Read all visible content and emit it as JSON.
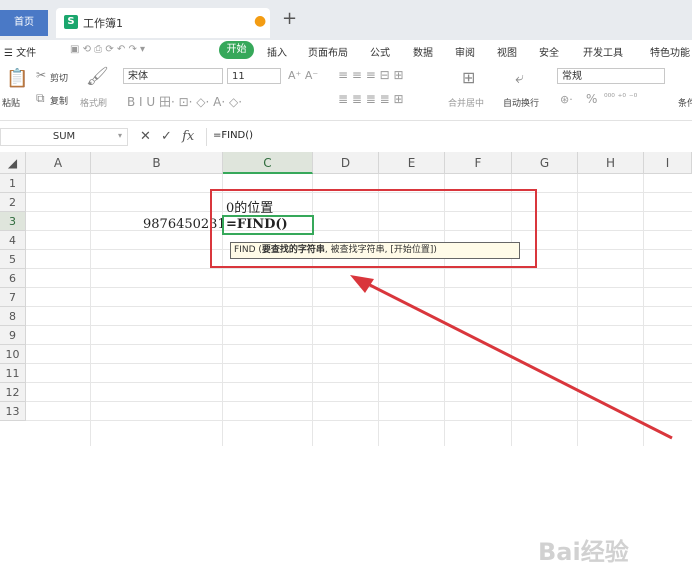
{
  "titlebar": {
    "home_label": "首页",
    "workbook_icon": "S",
    "workbook_name": "工作簿1",
    "new_tab": "+"
  },
  "menu": {
    "file": "☰ 文件",
    "start": "开始",
    "items": [
      "插入",
      "页面布局",
      "公式",
      "数据",
      "审阅",
      "视图",
      "安全",
      "开发工具",
      "特色功能"
    ]
  },
  "ribbon": {
    "cut": "剪切",
    "paste": "粘贴",
    "copy": "复制",
    "format_painter": "格式刷",
    "font_name": "宋体",
    "font_size": "11",
    "merge_center": "合并居中",
    "wrap_text": "自动换行",
    "number_format": "常规",
    "percent": "%",
    "conditional": "条件"
  },
  "formula_bar": {
    "name_box": "SUM",
    "cancel_icon": "✕",
    "confirm_icon": "✓",
    "fx": "fx",
    "formula": "=FIND()"
  },
  "columns": [
    "A",
    "B",
    "C",
    "D",
    "E",
    "F",
    "G",
    "H",
    "I"
  ],
  "rows": [
    "1",
    "2",
    "3",
    "4",
    "5",
    "6",
    "7",
    "8",
    "9",
    "10",
    "11",
    "12",
    "13"
  ],
  "cells": {
    "C2": "0的位置",
    "B3": "9876450231",
    "C3_edit": "=FIND()"
  },
  "tooltip": {
    "func": "FIND",
    "arg_current": "要查找的字符串",
    "rest": "被查找字符串, [开始位置])"
  },
  "watermark": "Bai经验",
  "colors": {
    "accent": "#36a85a",
    "annotation": "#d9363c"
  }
}
